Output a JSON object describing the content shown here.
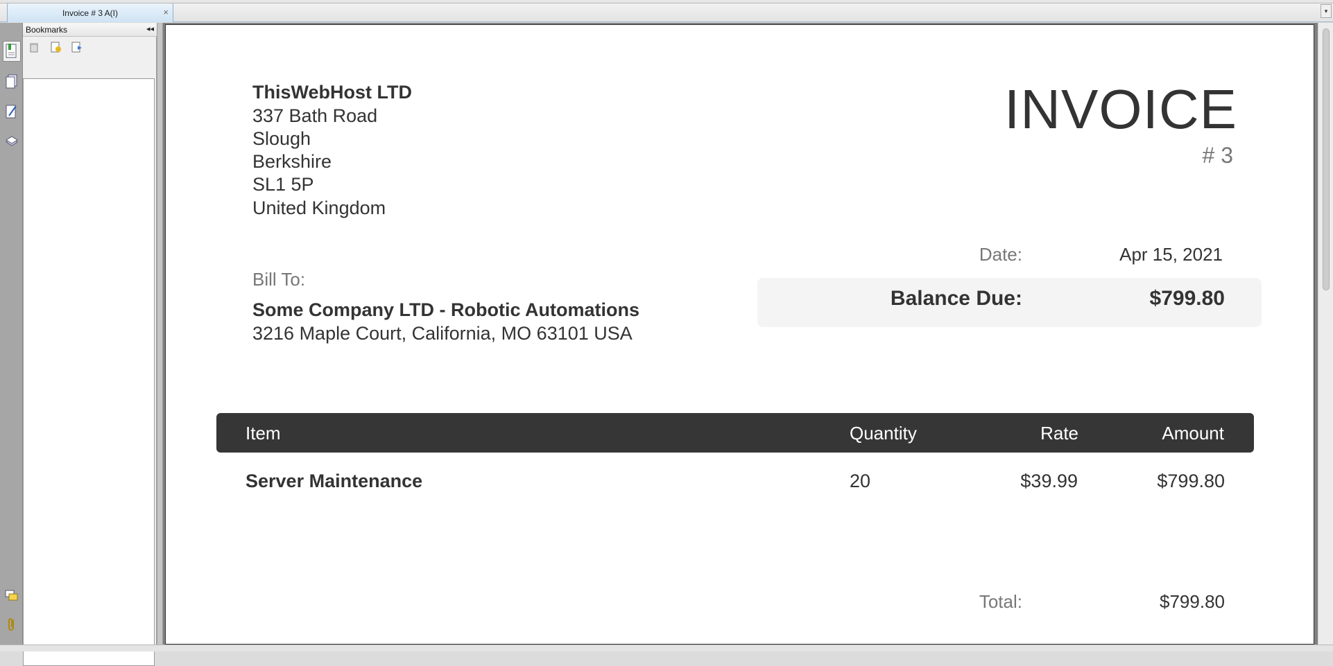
{
  "tabs": [
    {
      "label": "Invoice # 3 A(I)",
      "close": "×"
    }
  ],
  "tab_dropdown_glyph": "▾",
  "bookmarks": {
    "header": "Bookmarks",
    "collapse_glyph": "◂◂"
  },
  "invoice": {
    "company": {
      "name": "ThisWebHost LTD",
      "address": [
        "337 Bath Road",
        "Slough",
        "Berkshire",
        "SL1 5P",
        "United Kingdom"
      ]
    },
    "title": "INVOICE",
    "number": "# 3",
    "bill_to_label": "Bill To:",
    "client": {
      "name": "Some Company LTD - Robotic Automations",
      "address": "3216 Maple Court, California, MO 63101 USA"
    },
    "date_label": "Date:",
    "date_value": "Apr 15, 2021",
    "balance_label": "Balance Due:",
    "balance_value": "$799.80",
    "table": {
      "headers": [
        "Item",
        "Quantity",
        "Rate",
        "Amount"
      ],
      "rows": [
        [
          "Server Maintenance",
          "20",
          "$39.99",
          "$799.80"
        ]
      ]
    },
    "total_label": "Total:",
    "total_value": "$799.80"
  },
  "colors": {
    "table_header_bg": "#363636",
    "balance_bg": "#f4f4f4",
    "muted_text": "#777777",
    "body_text": "#333333"
  }
}
